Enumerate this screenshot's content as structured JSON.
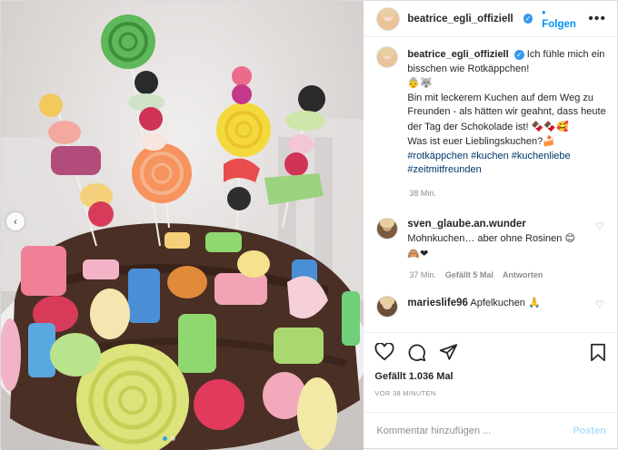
{
  "post": {
    "username": "beatrice_egli_offiziell",
    "follow_label": "Folgen",
    "more_label": "•••"
  },
  "caption": {
    "username": "beatrice_egli_offiziell",
    "line1": "Ich fühle mich ein bisschen wie Rotkäppchen!",
    "emoji1": "👵🐺",
    "line2": "Bin mit leckerem Kuchen auf dem Weg zu Freunden - als hätten wir geahnt, dass heute der Tag der Schokolade ist!",
    "emoji2": "🍫🍫🥰",
    "line3": "Was ist euer Lieblingskuchen?",
    "emoji3": "🍰",
    "hashtags": [
      "#rotkäppchen",
      "#kuchen",
      "#kuchenliebe",
      "#zeitmitfreunden"
    ],
    "age": "38 Min."
  },
  "comments": [
    {
      "username": "sven_glaube.an.wunder",
      "text": "Mohnkuchen… aber ohne Rosinen",
      "emoji": "😊🙈❤",
      "age": "37 Min.",
      "likes": "Gefällt 5 Mal",
      "reply": "Antworten"
    },
    {
      "username": "marieslife96",
      "text": "Apfelkuchen",
      "emoji": "🙏"
    }
  ],
  "stats": {
    "likes": "Gefällt 1.036 Mal",
    "time": "VOR 38 MINUTEN"
  },
  "composer": {
    "placeholder": "Kommentar hinzufügen ...",
    "post_label": "Posten"
  },
  "carousel": {
    "prev_label": "‹",
    "slide_count": 2,
    "active_slide": 1
  },
  "icons": [
    "heart-icon",
    "comment-icon",
    "share-icon",
    "bookmark-icon",
    "verified-badge-icon",
    "chevron-left-icon"
  ],
  "colors": {
    "link_blue": "#0095f6",
    "verified_blue": "#3897f0",
    "muted": "#8e8e8e",
    "hashtag": "#00376b"
  }
}
